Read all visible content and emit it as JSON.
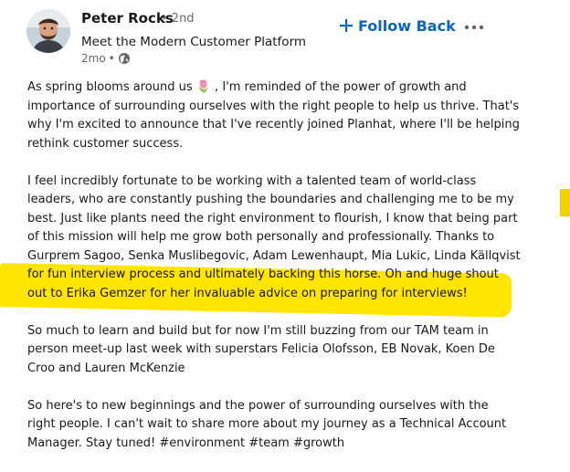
{
  "author": {
    "name": "Peter Rocks",
    "degree": "• 2nd",
    "headline": "Meet the Modern Customer Platform",
    "time": "2mo",
    "separator": "•"
  },
  "actions": {
    "follow_label": "Follow Back",
    "follow_icon": "plus-icon",
    "more_icon": "three-dots-icon"
  },
  "colors": {
    "accent": "#0a66c2",
    "highlight": "#ffe500"
  },
  "post": {
    "p1": [
      "As spring blooms around us 🌷 , I'm reminded of the power of growth and",
      "importance of surrounding ourselves with the right people to help us thrive. That's",
      "why I'm excited to announce that I've recently joined Planhat, where I'll be helping",
      "rethink customer success."
    ],
    "p2": [
      "I feel incredibly fortunate to be working with a talented team of world-class",
      "leaders, who are constantly pushing the boundaries and challenging me to be my",
      "best. Just like plants need the right environment to flourish, I know that being part",
      "of this mission will help me grow both personally and professionally. Thanks to",
      "Gurprem Sagoo, Senka Muslibegovic, Adam Lewenhaupt, Mia Lukic, Linda Källqvist"
    ],
    "p2_line6_a": "for fun interview process and ultimately backing this horse.",
    "p2_line6_b": "Oh and huge shout",
    "p2_line7": "out to Erika Gemzer for her invaluable advice on preparing for interviews!",
    "p3": [
      "So much to learn and build but for now I'm still buzzing from our TAM team in",
      "person meet-up last week with superstars Felicia Olofsson, EB Novak, Koen De",
      "Croo and Lauren McKenzie"
    ],
    "p4": [
      "So here's to new beginnings and the power of surrounding ourselves with the",
      "right people. I can't wait to share more about my journey as a Technical Account"
    ],
    "p4_last": "Manager. Stay tuned!",
    "hashtags": [
      "#environment",
      "#team",
      "#growth"
    ]
  }
}
